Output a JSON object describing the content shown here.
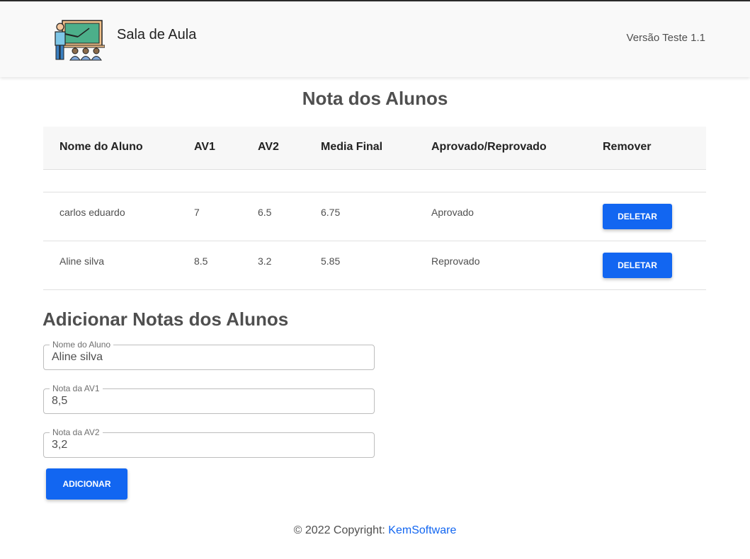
{
  "header": {
    "brand": "Sala de Aula",
    "version": "Versão Teste 1.1",
    "logo_icon": "teacher-classroom-icon"
  },
  "main": {
    "title": "Nota dos Alunos",
    "table": {
      "columns": [
        "Nome do Aluno",
        "AV1",
        "AV2",
        "Media Final",
        "Aprovado/Reprovado",
        "Remover"
      ],
      "rows": [
        {
          "name": "carlos eduardo",
          "av1": "7",
          "av2": "6.5",
          "media": "6.75",
          "status": "Aprovado",
          "action": "DELETAR"
        },
        {
          "name": "Aline silva",
          "av1": "8.5",
          "av2": "3.2",
          "media": "5.85",
          "status": "Reprovado",
          "action": "DELETAR"
        }
      ]
    }
  },
  "form": {
    "title": "Adicionar Notas dos Alunos",
    "name_label": "Nome do Aluno",
    "name_value": "Aline silva",
    "av1_label": "Nota da AV1",
    "av1_value": "8,5",
    "av2_label": "Nota da AV2",
    "av2_value": "3,2",
    "submit_label": "ADICIONAR"
  },
  "footer": {
    "copyright": "© 2022 Copyright: ",
    "link": "KemSoftware"
  },
  "colors": {
    "primary": "#1266f1",
    "navbar_bg": "#f9f9f9",
    "text": "#4f4f4f"
  }
}
